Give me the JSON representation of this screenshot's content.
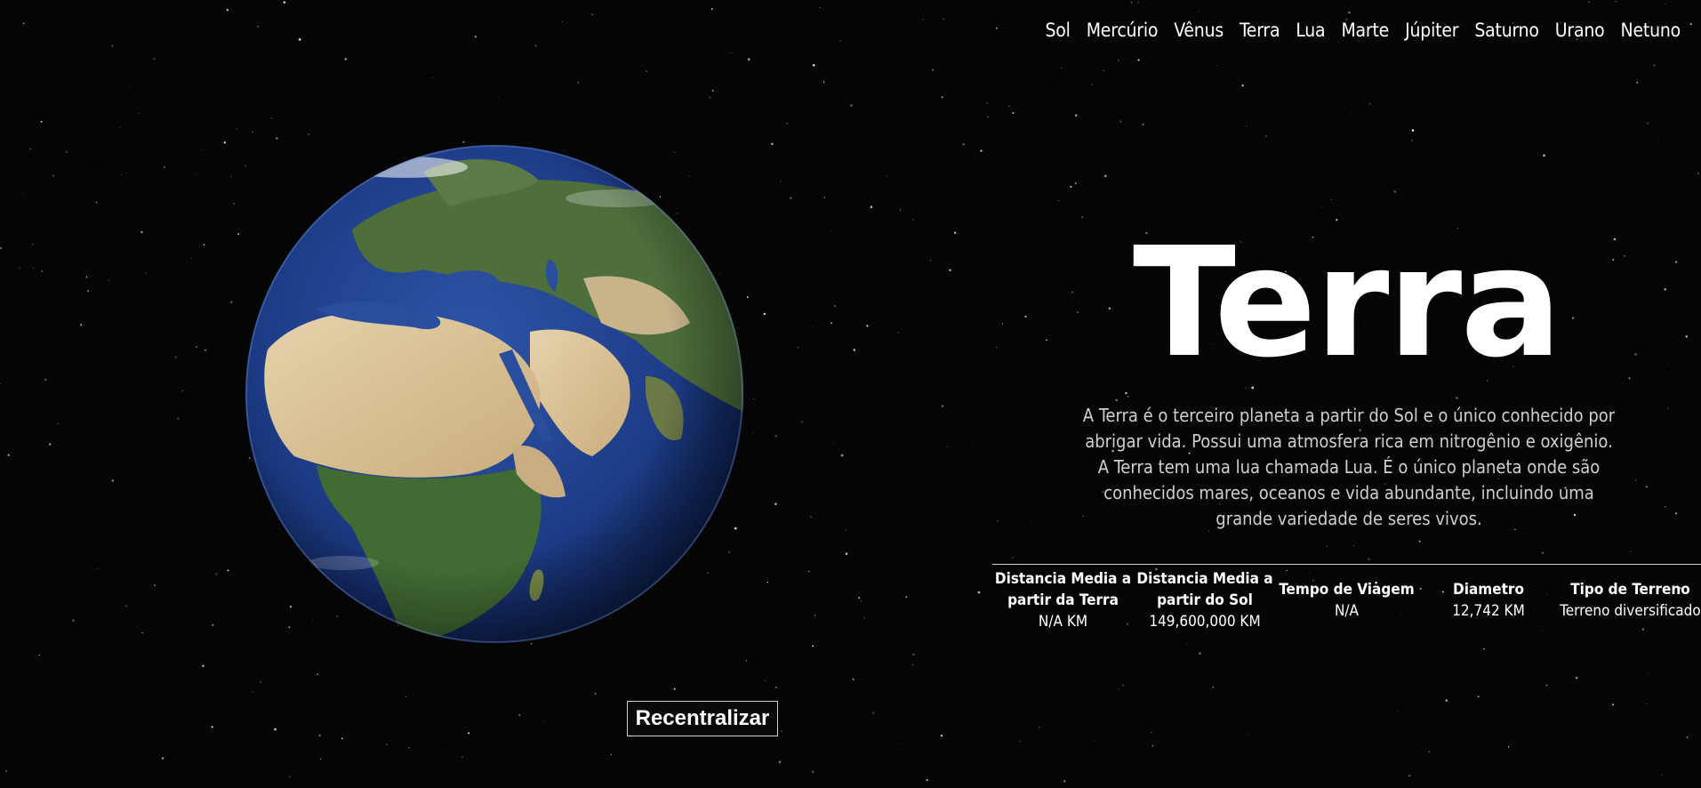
{
  "nav": {
    "items": [
      "Sol",
      "Mercúrio",
      "Vênus",
      "Terra",
      "Lua",
      "Marte",
      "Júpiter",
      "Saturno",
      "Urano",
      "Netuno"
    ]
  },
  "planet": {
    "name": "Terra",
    "description": "A Terra é o terceiro planeta a partir do Sol e o único conhecido por abrigar vida. Possui uma atmosfera rica em nitrogênio e oxigênio. A Terra tem uma lua chamada Lua. É o único planeta onde são conhecidos mares, oceanos e vida abundante, incluindo uma grande variedade de seres vivos."
  },
  "stats": [
    {
      "label": "Distancia Media a partir da Terra",
      "value": "N/A KM"
    },
    {
      "label": "Distancia Media a partir do Sol",
      "value": "149,600,000 KM"
    },
    {
      "label": "Tempo de Viagem",
      "value": "N/A"
    },
    {
      "label": "Diametro",
      "value": "12,742 KM"
    },
    {
      "label": "Tipo de Terreno",
      "value": "Terreno diversificado"
    }
  ],
  "recenter_button": {
    "label": "Recentralizar"
  },
  "colors": {
    "background": "#050505",
    "ocean": "#1f3f86",
    "land_green": "#3f6a3a",
    "desert": "#d8c29c",
    "text": "#ffffff",
    "text_muted": "#cfcfcf"
  }
}
